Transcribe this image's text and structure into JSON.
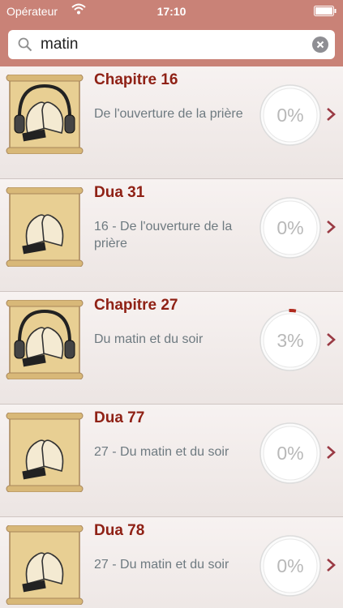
{
  "status_bar": {
    "carrier": "Opérateur",
    "time": "17:10"
  },
  "search": {
    "query": "matin"
  },
  "colors": {
    "accent": "#c98277",
    "title": "#8f2115",
    "subtitle": "#6e7a80",
    "progress_mark": "#b02a1e"
  },
  "items": [
    {
      "title": "Chapitre 16",
      "subtitle": "De l'ouverture de la prière",
      "progress_label": "0%",
      "progress": 0,
      "icon": "headphones-hands-icon"
    },
    {
      "title": "Dua 31",
      "subtitle": "16 - De l'ouverture de la prière",
      "progress_label": "0%",
      "progress": 0,
      "icon": "praying-hands-icon"
    },
    {
      "title": "Chapitre 27",
      "subtitle": "Du matin et du soir",
      "progress_label": "3%",
      "progress": 3,
      "icon": "headphones-hands-icon"
    },
    {
      "title": "Dua 77",
      "subtitle": "27 - Du matin et du soir",
      "progress_label": "0%",
      "progress": 0,
      "icon": "praying-hands-icon"
    },
    {
      "title": "Dua 78",
      "subtitle": "27 - Du matin et du soir",
      "progress_label": "0%",
      "progress": 0,
      "icon": "praying-hands-icon"
    }
  ]
}
